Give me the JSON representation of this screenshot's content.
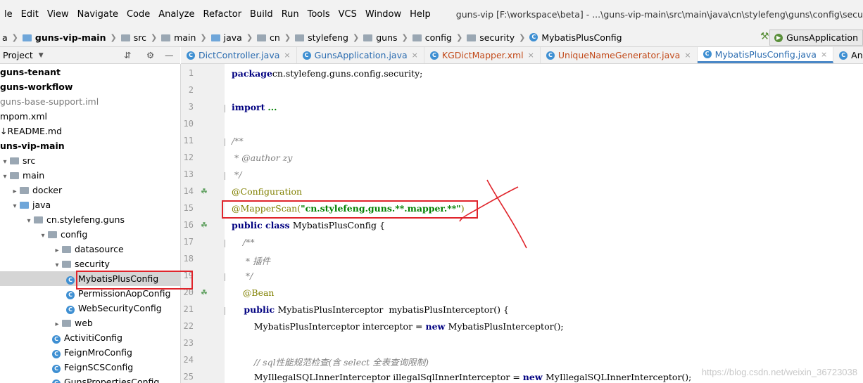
{
  "menu": {
    "items": [
      "le",
      "Edit",
      "View",
      "Navigate",
      "Code",
      "Analyze",
      "Refactor",
      "Build",
      "Run",
      "Tools",
      "VCS",
      "Window",
      "Help"
    ],
    "window_title": "guns-vip [F:\\workspace\\beta] - ...\\guns-vip-main\\src\\main\\java\\cn\\stylefeng\\guns\\config\\security\\MybatisPlusConfig"
  },
  "breadcrumb": [
    "a",
    "guns-vip-main",
    "src",
    "main",
    "java",
    "cn",
    "stylefeng",
    "guns",
    "config",
    "security",
    "MybatisPlusConfig"
  ],
  "run_config": "GunsApplication",
  "project_panel": {
    "title": "Project",
    "toggle_icon": "chevron-down-icon"
  },
  "tree": [
    {
      "label": "guns-tenant",
      "style": "bold",
      "icon": "none"
    },
    {
      "label": "guns-workflow",
      "style": "bold",
      "icon": "none"
    },
    {
      "label": "guns-base-support.iml",
      "style": "gray",
      "icon": "none"
    },
    {
      "label": "pom.xml",
      "style": "normal",
      "icon": "maven-icon"
    },
    {
      "label": "README.md",
      "style": "normal",
      "icon": "markdown-icon"
    },
    {
      "label": "uns-vip-main",
      "style": "bold",
      "icon": "none"
    },
    {
      "label": "src",
      "style": "normal",
      "icon": "folder-icon"
    },
    {
      "label": "main",
      "style": "normal",
      "icon": "folder-icon"
    },
    {
      "label": "docker",
      "style": "normal",
      "icon": "folder-icon"
    },
    {
      "label": "java",
      "style": "normal",
      "icon": "folder-icon"
    },
    {
      "label": "cn.stylefeng.guns",
      "style": "normal",
      "icon": "package-icon"
    },
    {
      "label": "config",
      "style": "normal",
      "icon": "package-icon"
    },
    {
      "label": "datasource",
      "style": "normal",
      "icon": "package-icon"
    },
    {
      "label": "security",
      "style": "normal",
      "icon": "package-icon"
    },
    {
      "label": "MybatisPlusConfig",
      "style": "normal",
      "icon": "class-icon"
    },
    {
      "label": "PermissionAopConfig",
      "style": "normal",
      "icon": "class-icon"
    },
    {
      "label": "WebSecurityConfig",
      "style": "normal",
      "icon": "class-icon"
    },
    {
      "label": "web",
      "style": "normal",
      "icon": "package-icon"
    },
    {
      "label": "ActivitiConfig",
      "style": "normal",
      "icon": "class-icon"
    },
    {
      "label": "FeignMroConfig",
      "style": "normal",
      "icon": "class-icon"
    },
    {
      "label": "FeignSCSConfig",
      "style": "normal",
      "icon": "class-icon"
    },
    {
      "label": "GunsPropertiesConfig",
      "style": "normal",
      "icon": "class-icon"
    }
  ],
  "tabs": [
    {
      "label": "DictController.java",
      "color": "#2b6cb0"
    },
    {
      "label": "GunsApplication.java",
      "color": "#2b6cb0"
    },
    {
      "label": "KGDictMapper.xml",
      "color": "#c24a1a"
    },
    {
      "label": "UniqueNameGenerator.java",
      "color": "#c24a1a"
    },
    {
      "label": "MybatisPlusConfig.java",
      "color": "#2b6cb0"
    },
    {
      "label": "AnnotationBe",
      "color": "#000000"
    }
  ],
  "code": [
    {
      "ln": "1",
      "tokens": [
        [
          "kw",
          "package"
        ],
        [
          "",
          "cn.stylefeng.guns.config.security;"
        ]
      ]
    },
    {
      "ln": "2",
      "tokens": []
    },
    {
      "ln": "3",
      "tokens": [
        [
          "kw",
          "import"
        ],
        [
          "",
          ""
        ],
        [
          "str",
          "..."
        ]
      ]
    },
    {
      "ln": "10",
      "tokens": []
    },
    {
      "ln": "11",
      "tokens": [
        [
          "cmt",
          "/**"
        ]
      ]
    },
    {
      "ln": "12",
      "tokens": [
        [
          "cmt",
          " * @author zy"
        ]
      ]
    },
    {
      "ln": "13",
      "tokens": [
        [
          "cmt",
          " */"
        ]
      ]
    },
    {
      "ln": "14",
      "tokens": [
        [
          "ann",
          "@Configuration"
        ]
      ]
    },
    {
      "ln": "15",
      "tokens": [
        [
          "ann",
          "@MapperScan("
        ],
        [
          "str",
          "\"cn.stylefeng.guns.**.mapper.**\""
        ],
        [
          "ann",
          ")"
        ]
      ]
    },
    {
      "ln": "16",
      "tokens": [
        [
          "kw",
          "public class "
        ],
        [
          "",
          "MybatisPlusConfig {"
        ]
      ]
    },
    {
      "ln": "17",
      "tokens": [
        [
          "cmt",
          "    /**"
        ]
      ]
    },
    {
      "ln": "18",
      "tokens": [
        [
          "cmt",
          "     * 插件"
        ]
      ]
    },
    {
      "ln": "19",
      "tokens": [
        [
          "cmt",
          "     */"
        ]
      ]
    },
    {
      "ln": "20",
      "tokens": [
        [
          "ann",
          "    @Bean"
        ]
      ]
    },
    {
      "ln": "21",
      "tokens": [
        [
          "kw",
          "    public "
        ],
        [
          "",
          "MybatisPlusInterceptor  mybatisPlusInterceptor() {"
        ]
      ]
    },
    {
      "ln": "22",
      "tokens": [
        [
          "",
          "        MybatisPlusInterceptor interceptor = "
        ],
        [
          "kw",
          "new "
        ],
        [
          "",
          "MybatisPlusInterceptor();"
        ]
      ]
    },
    {
      "ln": "23",
      "tokens": []
    },
    {
      "ln": "24",
      "tokens": [
        [
          "cmt",
          "        // sql性能规范检查(含 select 全表查询限制)"
        ]
      ]
    },
    {
      "ln": "25",
      "tokens": [
        [
          "",
          "        MyIllegalSQLInnerInterceptor illegalSqlInnerInterceptor = "
        ],
        [
          "kw",
          "new "
        ],
        [
          "",
          "MyIllegalSQLInnerInterceptor();"
        ]
      ]
    }
  ],
  "watermark": "https://blog.csdn.net/weixin_36723038"
}
